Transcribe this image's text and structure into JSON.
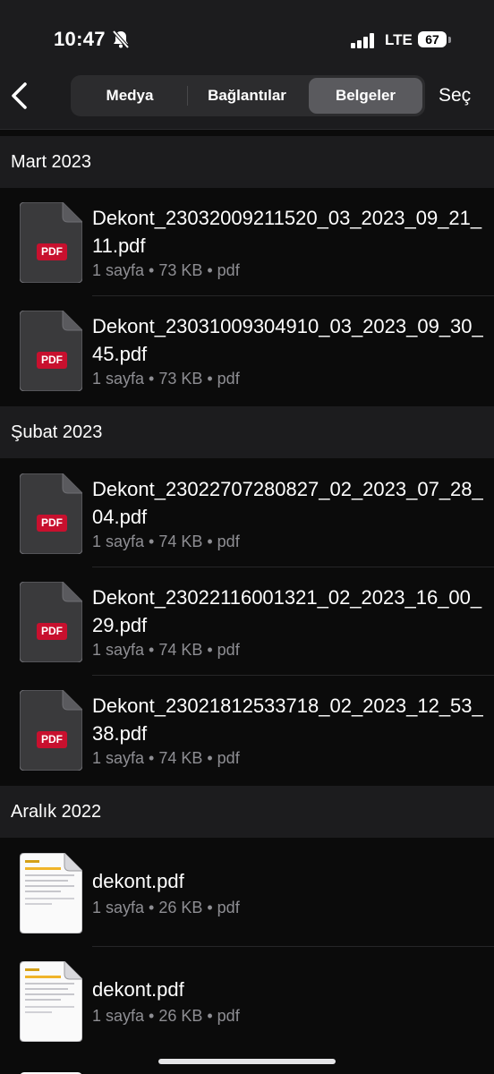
{
  "status_bar": {
    "time": "10:47",
    "network": "LTE",
    "battery": "67"
  },
  "nav": {
    "segments": [
      "Medya",
      "Bağlantılar",
      "Belgeler"
    ],
    "selected_segment": "Belgeler",
    "select_label": "Seç"
  },
  "sections": [
    {
      "title": "Mart 2023",
      "files": [
        {
          "name": "Dekont_23032009211520_03_2023_09_21_11.pdf",
          "meta": "1 sayfa • 73 KB • pdf",
          "icon": "pdf-icon"
        },
        {
          "name": "Dekont_23031009304910_03_2023_09_30_45.pdf",
          "meta": "1 sayfa • 73 KB • pdf",
          "icon": "pdf-icon"
        }
      ]
    },
    {
      "title": "Şubat 2023",
      "files": [
        {
          "name": "Dekont_23022707280827_02_2023_07_28_04.pdf",
          "meta": "1 sayfa • 74 KB • pdf",
          "icon": "pdf-icon"
        },
        {
          "name": "Dekont_23022116001321_02_2023_16_00_29.pdf",
          "meta": "1 sayfa • 74 KB • pdf",
          "icon": "pdf-icon"
        },
        {
          "name": "Dekont_23021812533718_02_2023_12_53_38.pdf",
          "meta": "1 sayfa • 74 KB • pdf",
          "icon": "pdf-icon"
        }
      ]
    },
    {
      "title": "Aralık 2022",
      "files": [
        {
          "name": "dekont.pdf",
          "meta": "1 sayfa • 26 KB • pdf",
          "icon": "document-thumbnail-icon"
        },
        {
          "name": "dekont.pdf",
          "meta": "1 sayfa • 26 KB • pdf",
          "icon": "document-thumbnail-icon"
        }
      ]
    }
  ],
  "pdf_badge": "PDF",
  "colors": {
    "accent_pdf": "#c8102e",
    "background": "#0b0b0b",
    "header": "#1c1c1e",
    "secondary_text": "#8e8e93"
  }
}
